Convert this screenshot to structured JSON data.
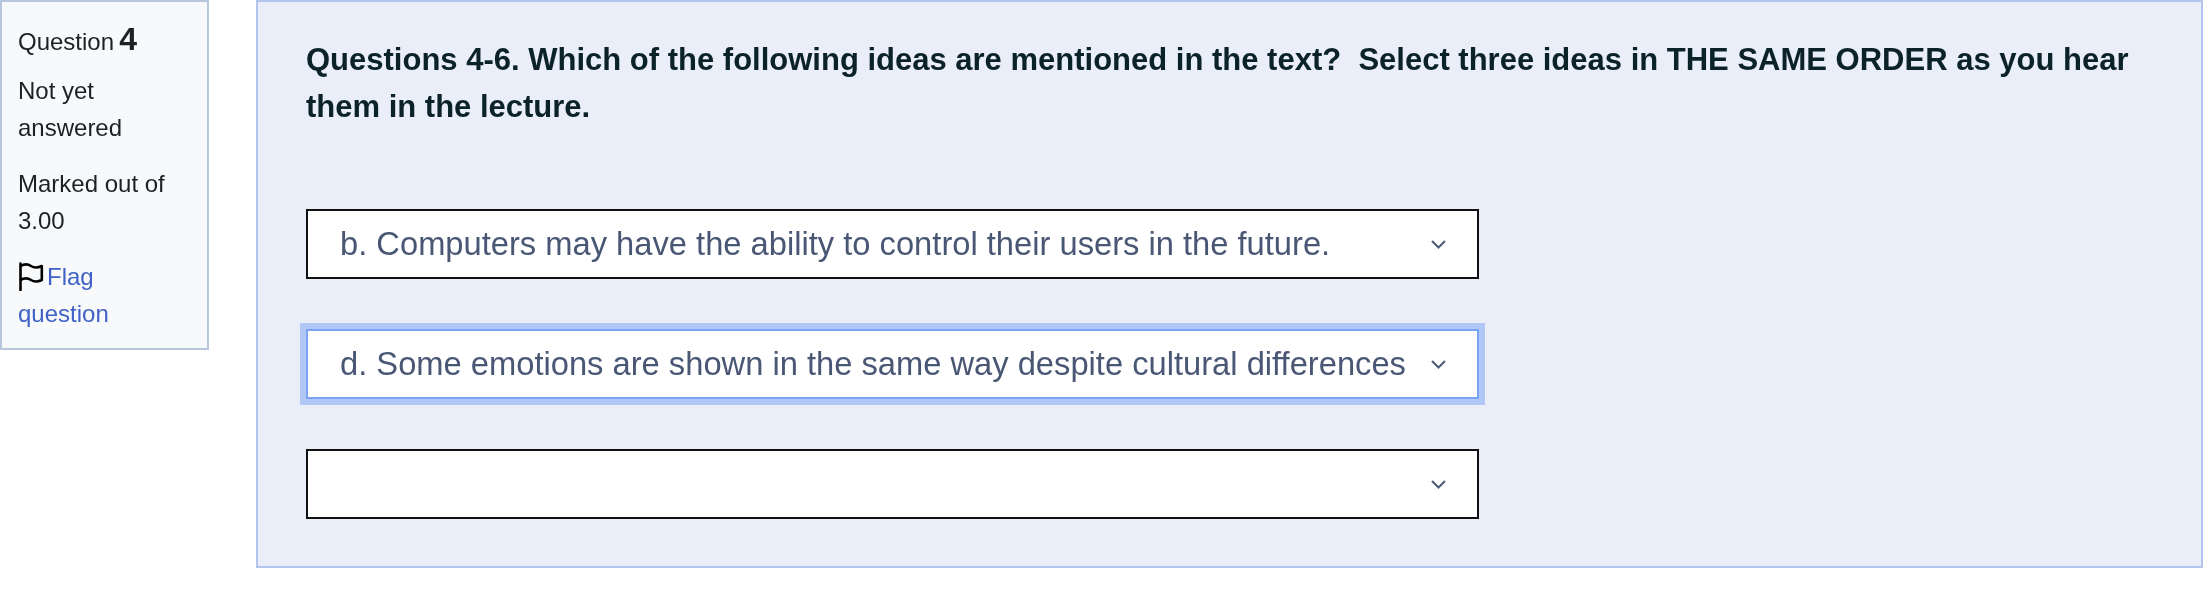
{
  "question_info": {
    "label": "Question",
    "number": "4",
    "status": "Not yet answered",
    "marks": "Marked out of 3.00",
    "flag_link": "Flag question"
  },
  "question": {
    "text": "Questions 4-6. Which of the following ideas are mentioned in the text?  Select three ideas in THE SAME ORDER as you hear them in the lecture.",
    "answers": [
      {
        "value": "b. Computers may have the ability to control their users in the future.",
        "focused": false
      },
      {
        "value": "d. Some emotions are shown in the same way despite cultural differences",
        "focused": true
      },
      {
        "focused": false
      }
    ]
  }
}
